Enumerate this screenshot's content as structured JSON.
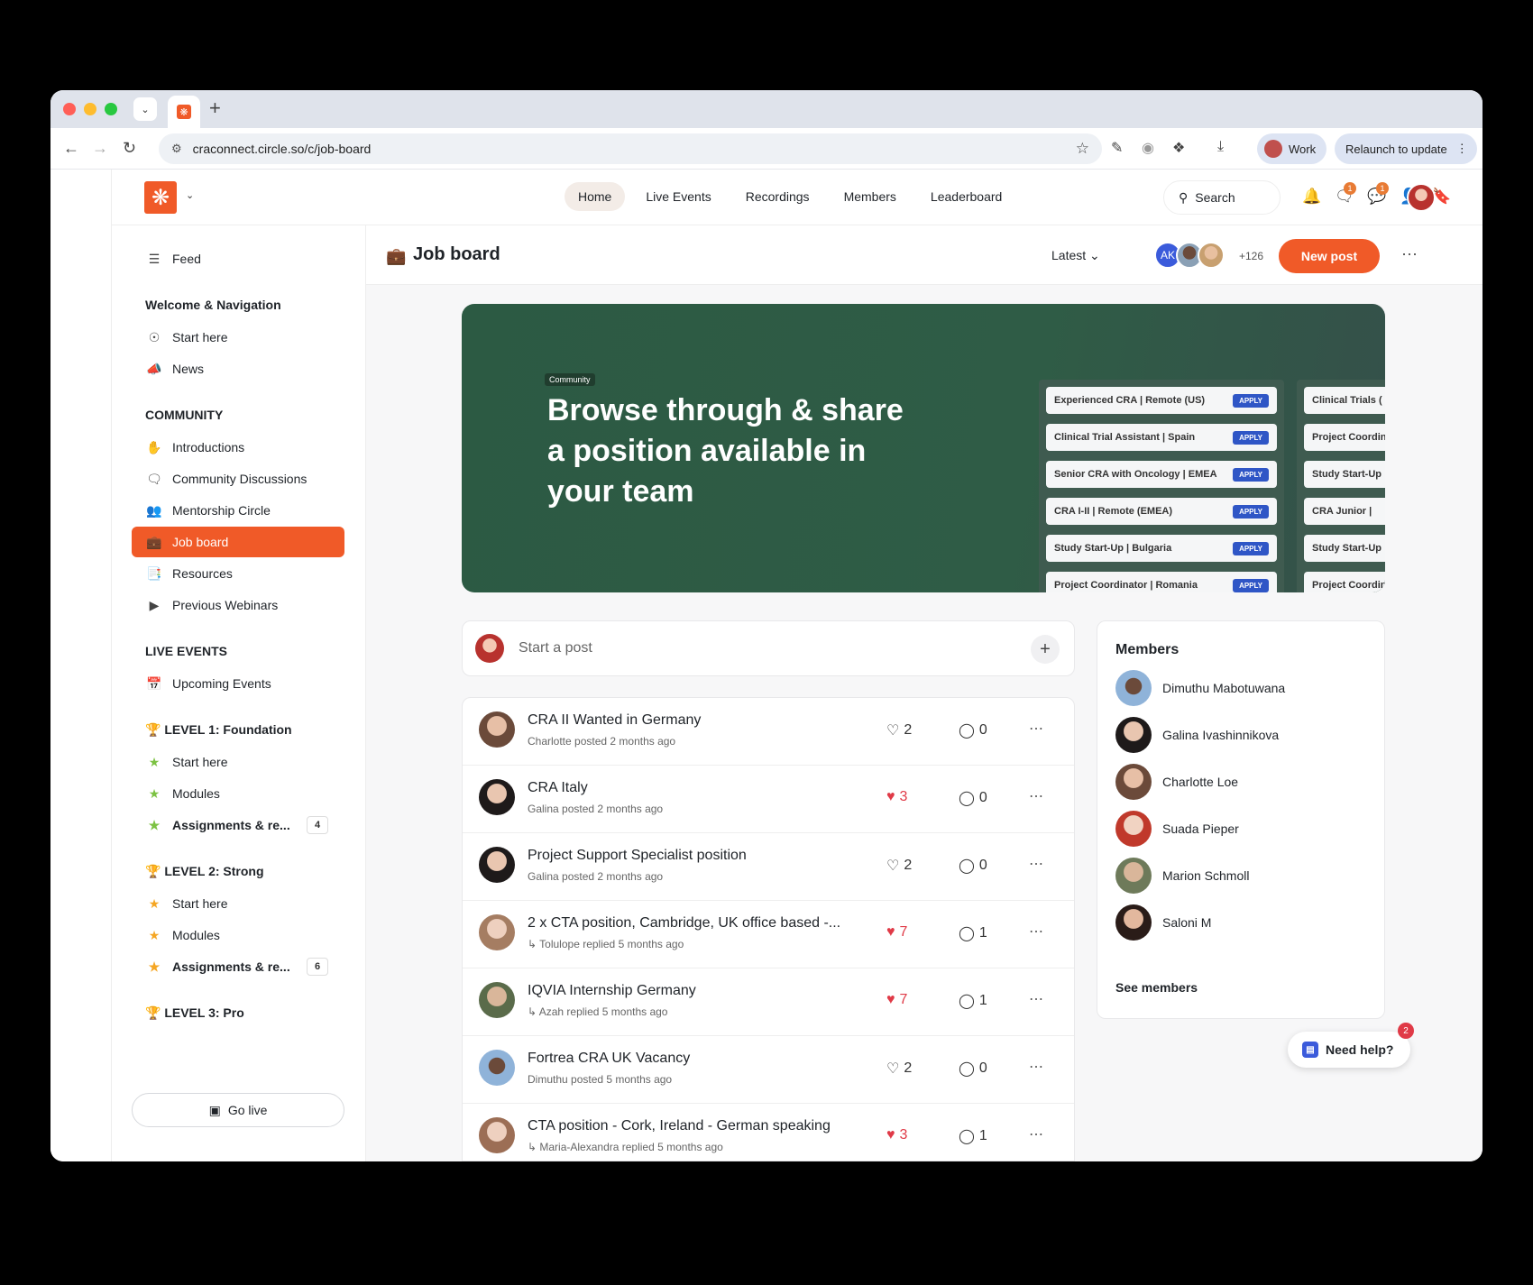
{
  "browser": {
    "url": "craconnect.circle.so/c/job-board",
    "profile_label": "Work",
    "relaunch_label": "Relaunch to update",
    "new_tab_symbol": "+"
  },
  "header": {
    "nav": [
      "Home",
      "Live Events",
      "Recordings",
      "Members",
      "Leaderboard"
    ],
    "active_nav": "Home",
    "search_label": "Search",
    "chat_badge": "1",
    "messages_badge": "1"
  },
  "sidebar": {
    "feed": "Feed",
    "section_welcome": "Welcome & Navigation",
    "start_here": "Start here",
    "news": "News",
    "section_community": "COMMUNITY",
    "introductions": "Introductions",
    "community_discussions": "Community Discussions",
    "mentorship_circle": "Mentorship Circle",
    "job_board": "Job board",
    "resources": "Resources",
    "previous_webinars": "Previous Webinars",
    "section_live_events": "LIVE EVENTS",
    "upcoming_events": "Upcoming Events",
    "level1": "🏆 LEVEL 1: Foundation",
    "l1_start": "Start here",
    "l1_modules": "Modules",
    "l1_assign": "Assignments & re...",
    "l1_count": "4",
    "level2": "🏆 LEVEL 2: Strong",
    "l2_start": "Start here",
    "l2_modules": "Modules",
    "l2_assign": "Assignments & re...",
    "l2_count": "6",
    "level3": "🏆 LEVEL 3: Pro",
    "go_live": "Go live"
  },
  "main": {
    "title": "Job board",
    "sort": "Latest",
    "avatar_initials": "AK",
    "member_extra": "+126",
    "new_post": "New post",
    "banner": {
      "tag": "Community",
      "title": "Browse through & share a position available in your team",
      "apply": "APPLY",
      "jobs": [
        "Experienced CRA  |  Remote (US)",
        "Clinical Trial Assistant  |  Spain",
        "Senior CRA with Oncology  |  EMEA",
        "CRA I-II  |  Remote (EMEA)",
        "Study Start-Up  |  Bulgaria",
        "Project Coordinator  |  Romania"
      ],
      "jobs2": [
        "Clinical Trials (",
        "Project Coordin",
        "Study Start-Up",
        "CRA Junior  |",
        "Study Start-Up",
        "Project Coordin"
      ]
    },
    "start_post": "Start a post",
    "posts": [
      {
        "title": "CRA II Wanted in Germany",
        "meta": "Charlotte posted 2 months ago",
        "likes": "2",
        "liked": false,
        "comments": "0"
      },
      {
        "title": "CRA Italy",
        "meta": "Galina posted 2 months ago",
        "likes": "3",
        "liked": true,
        "comments": "0"
      },
      {
        "title": "Project Support Specialist position",
        "meta": "Galina posted 2 months ago",
        "likes": "2",
        "liked": false,
        "comments": "0"
      },
      {
        "title": "2 x CTA position, Cambridge, UK office based -...",
        "meta": "↳ Tolulope replied 5 months ago",
        "likes": "7",
        "liked": true,
        "comments": "1"
      },
      {
        "title": "IQVIA Internship Germany",
        "meta": "↳ Azah replied 5 months ago",
        "likes": "7",
        "liked": true,
        "comments": "1"
      },
      {
        "title": "Fortrea CRA UK Vacancy",
        "meta": "Dimuthu posted 5 months ago",
        "likes": "2",
        "liked": false,
        "comments": "0"
      },
      {
        "title": "CTA position - Cork, Ireland - German speaking",
        "meta": "↳ Maria-Alexandra replied 5 months ago",
        "likes": "3",
        "liked": true,
        "comments": "1"
      }
    ]
  },
  "members": {
    "title": "Members",
    "list": [
      "Dimuthu Mabotuwana",
      "Galina Ivashinnikova",
      "Charlotte Loe",
      "Suada Pieper",
      "Marion Schmoll",
      "Saloni M"
    ],
    "see_all": "See members"
  },
  "help": {
    "label": "Need help?",
    "badge": "2"
  },
  "colors": {
    "brand": "#f05a28",
    "banner": "#2c5a43",
    "like_red": "#e03a47"
  }
}
